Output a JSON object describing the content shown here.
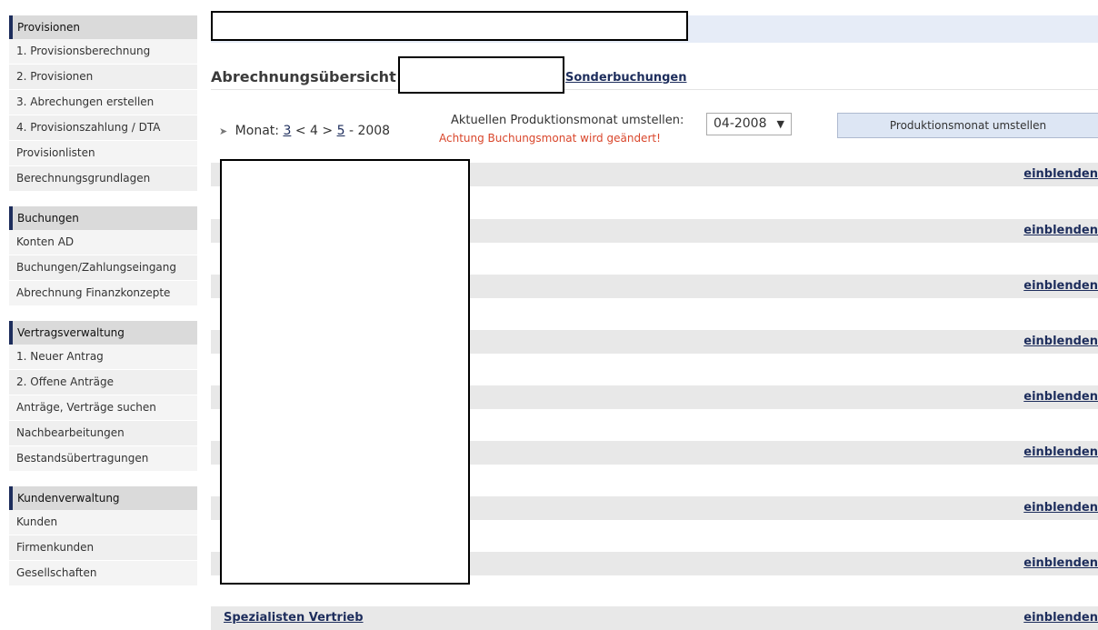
{
  "sidebar": {
    "groups": [
      {
        "title": "Provisionen",
        "items": [
          "1. Provisionsberechnung",
          "2. Provisionen",
          "3. Abrechungen erstellen",
          "4. Provisionszahlung / DTA",
          "Provisionlisten",
          "Berechnungsgrundlagen"
        ]
      },
      {
        "title": "Buchungen",
        "items": [
          "Konten AD",
          "Buchungen/Zahlungseingang",
          "Abrechnung Finanzkonzepte"
        ]
      },
      {
        "title": "Vertragsverwaltung",
        "items": [
          "1. Neuer Antrag",
          "2. Offene Anträge",
          "Anträge, Verträge suchen",
          "Nachbearbeitungen",
          "Bestandsübertragungen"
        ]
      },
      {
        "title": "Kundenverwaltung",
        "items": [
          "Kunden",
          "Firmenkunden",
          "Gesellschaften"
        ]
      }
    ]
  },
  "tabs": {
    "title": "Abrechnungsübersicht",
    "link": "Sonderbuchungen"
  },
  "month": {
    "label": "Monat:",
    "prev": "3",
    "lt": "<",
    "current": "4",
    "gt": ">",
    "next": "5",
    "sep": "-",
    "year": "2008"
  },
  "production": {
    "label": "Aktuellen Produktionsmonat umstellen:",
    "selected": "04-2008",
    "warning": "Achtung Buchungsmonat wird geändert!",
    "button": "Produktionsmonat umstellen"
  },
  "rows": [
    {
      "name": "",
      "toggle": "einblenden"
    },
    {
      "name": "",
      "toggle": "einblenden"
    },
    {
      "name": "",
      "toggle": "einblenden"
    },
    {
      "name": "",
      "toggle": "einblenden"
    },
    {
      "name": "",
      "toggle": "einblenden"
    },
    {
      "name": "",
      "toggle": "einblenden"
    },
    {
      "name": "",
      "toggle": "einblenden"
    },
    {
      "name": "",
      "toggle": "einblenden"
    },
    {
      "name": "Spezialisten Vertrieb",
      "toggle": "einblenden"
    }
  ],
  "colors": {
    "accent": "#1d2d5c",
    "warning": "#d9462b",
    "row_bg": "#e8e8e8",
    "top_strip": "#e6ecf7"
  }
}
